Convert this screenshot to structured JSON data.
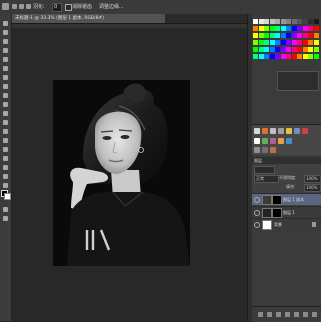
{
  "options_bar": {
    "feather_label": "羽化:",
    "feather_value": "0",
    "antialias_label": "消除锯齿",
    "adjust_edge_label": "调整边缘..."
  },
  "document_tab": {
    "title": "未标题-1 @ 33.3% (图层 1 副本, RGB/8#)"
  },
  "layers_panel": {
    "tab_label": "图层",
    "blend_mode": "正常",
    "opacity_label": "不透明度:",
    "opacity_value": "100%",
    "fill_label": "填充:",
    "fill_value": "100%",
    "layers": [
      {
        "name": "图层 1 副本",
        "selected": true
      },
      {
        "name": "图层 1",
        "selected": false
      },
      {
        "name": "背景",
        "selected": false
      }
    ]
  },
  "icons": [
    "marquee-icon",
    "move-icon",
    "lasso-icon",
    "quick-select-icon",
    "crop-icon",
    "eyedropper-icon",
    "healing-icon",
    "brush-icon",
    "stamp-icon",
    "history-brush-icon",
    "eraser-icon",
    "gradient-icon",
    "blur-icon",
    "dodge-icon",
    "pen-icon",
    "type-icon",
    "path-select-icon",
    "shape-icon",
    "hand-icon",
    "zoom-icon"
  ]
}
